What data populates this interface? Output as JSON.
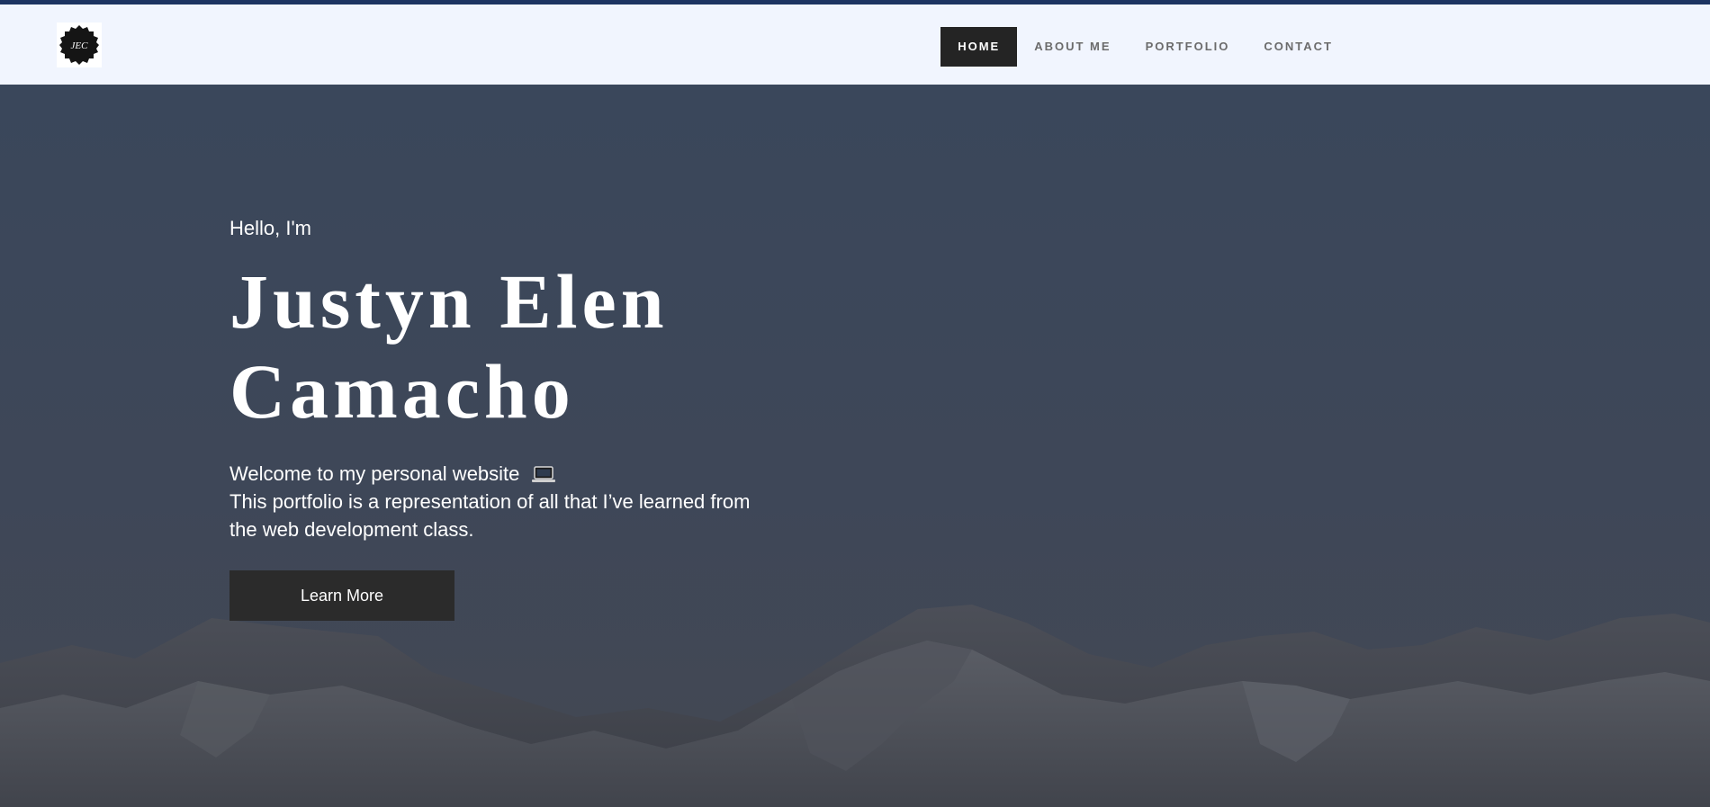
{
  "brand": {
    "logo_text": "JEC"
  },
  "nav": {
    "items": [
      {
        "label": "HOME",
        "active": true
      },
      {
        "label": "ABOUT ME",
        "active": false
      },
      {
        "label": "PORTFOLIO",
        "active": false
      },
      {
        "label": "CONTACT",
        "active": false
      }
    ]
  },
  "hero": {
    "greeting": "Hello, I'm",
    "name_line1": "Justyn Elen",
    "name_line2": "Camacho",
    "intro_line1": "Welcome to my personal website",
    "intro_icon": "laptop-icon",
    "intro_line2": "This portfolio is a representation of all that I’ve learned from",
    "intro_line3": "the web development class.",
    "button_label": "Learn More"
  },
  "colors": {
    "topline": "#1d3461",
    "navbar_bg": "#f1f5fe",
    "nav_active_bg": "#242424",
    "hero_bg": "#3b4558",
    "button_bg": "#2b2b2b"
  }
}
